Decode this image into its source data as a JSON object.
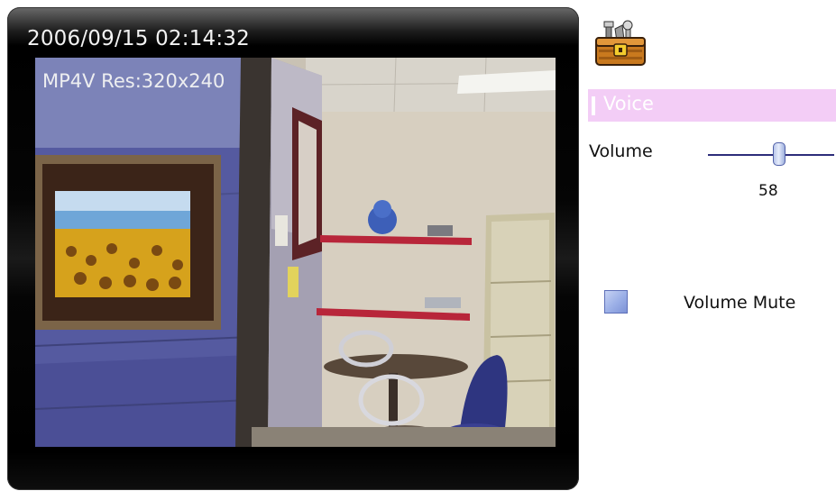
{
  "video": {
    "timestamp": "2006/09/15 02:14:32",
    "codec_info": "MP4V Res:320x240"
  },
  "controls": {
    "toolbox_icon": "toolbox-icon",
    "section_title": "Voice",
    "section_color": "#f3cdf6",
    "volume": {
      "label": "Volume",
      "value": "58",
      "level": 58
    },
    "mute": {
      "label": "Volume Mute",
      "checked": false
    }
  }
}
